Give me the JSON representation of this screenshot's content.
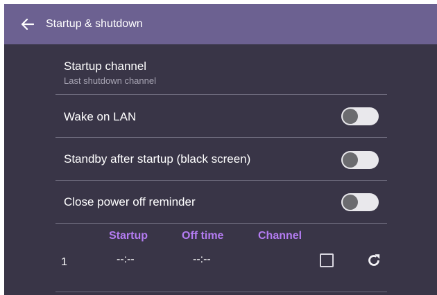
{
  "header": {
    "title": "Startup & shutdown"
  },
  "settings": {
    "startup_channel": {
      "label": "Startup channel",
      "value": "Last shutdown channel"
    },
    "wake_on_lan": {
      "label": "Wake on LAN",
      "enabled": false
    },
    "standby_after_startup": {
      "label": "Standby after startup (black screen)",
      "enabled": false
    },
    "close_power_off_reminder": {
      "label": "Close power off reminder",
      "enabled": false
    }
  },
  "schedule": {
    "columns": [
      "Startup",
      "Off time",
      "Channel"
    ],
    "rows": [
      {
        "index": "1",
        "startup": "--:--",
        "off_time": "--:--",
        "channel": "",
        "checked": false
      }
    ]
  },
  "colors": {
    "header_bg": "#6c6191",
    "panel_bg": "#393547",
    "accent": "#b47cf2",
    "divider": "#6d6a7c"
  },
  "icons": [
    "back-arrow-icon",
    "checkbox-icon",
    "refresh-icon"
  ]
}
